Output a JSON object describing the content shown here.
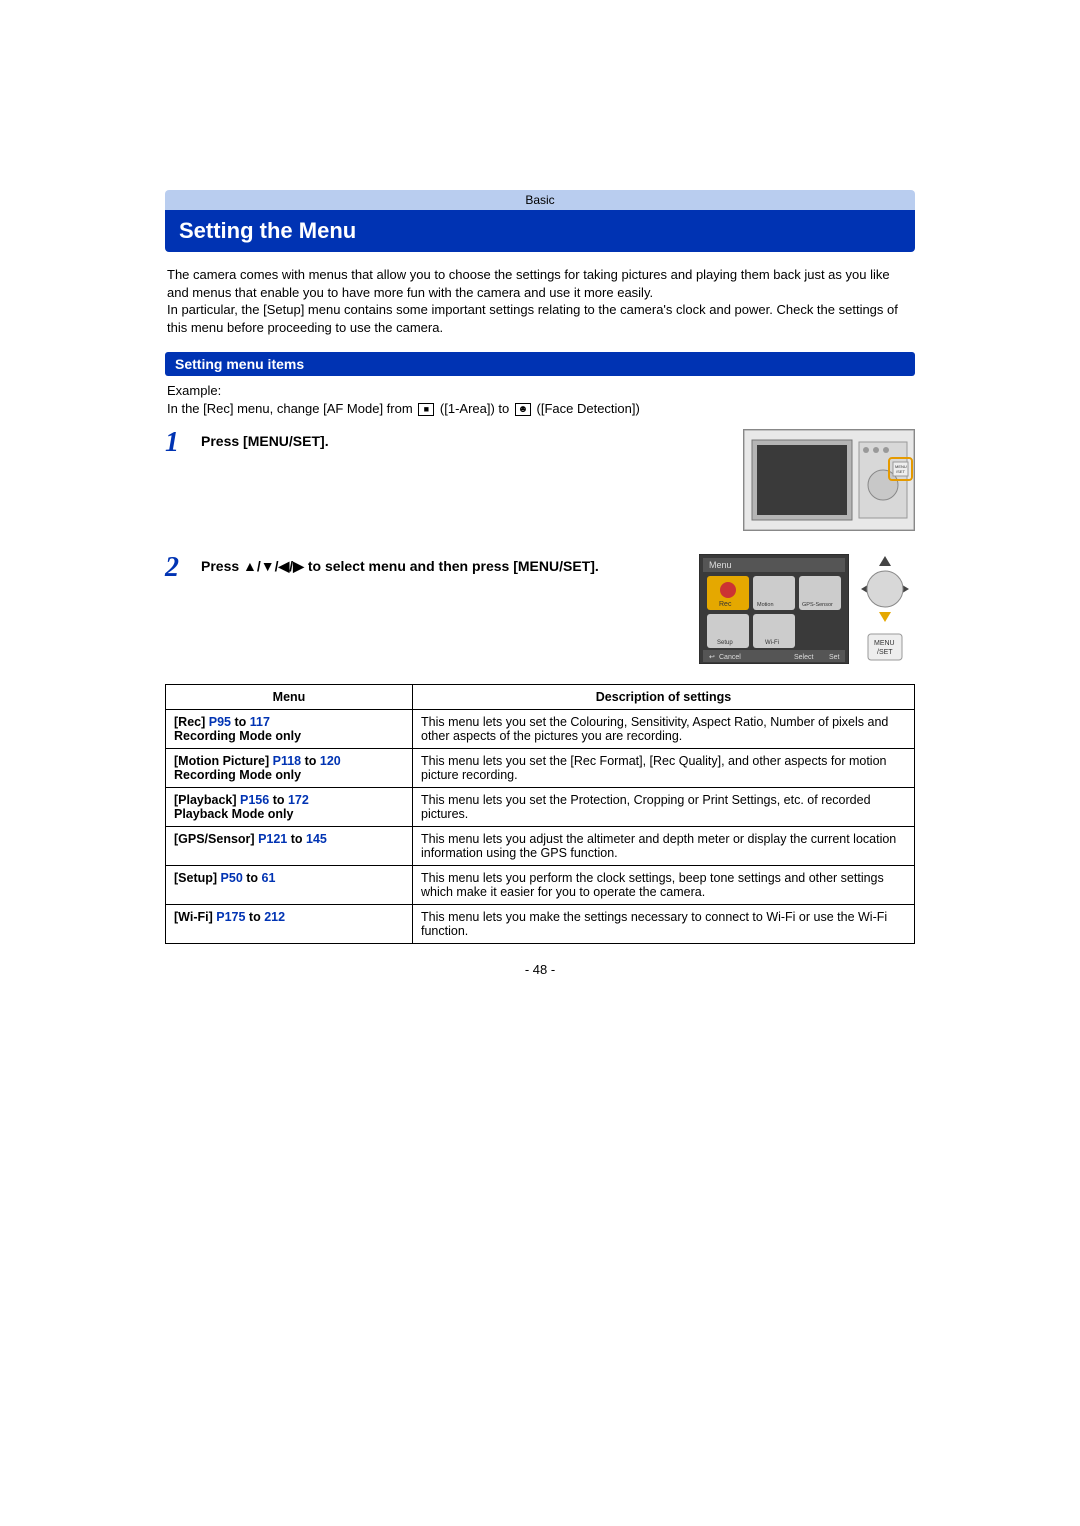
{
  "breadcrumb": "Basic",
  "title": "Setting the Menu",
  "intro_p1": "The camera comes with menus that allow you to choose the settings for taking pictures and playing them back just as you like and menus that enable you to have more fun with the camera and use it more easily.",
  "intro_p2": "In particular, the [Setup] menu contains some important settings relating to the camera's clock and power. Check the settings of this menu before proceeding to use the camera.",
  "section_header": "Setting menu items",
  "example_label": "Example:",
  "example_line_a": "In the [Rec] menu, change [AF Mode] from ",
  "example_line_b": " ([1-Area]) to ",
  "example_line_c": " ([Face Detection])",
  "step1": {
    "num": "1",
    "text": "Press [MENU/SET]."
  },
  "step2": {
    "num": "2",
    "text": "Press ▲/▼/◀/▶ to select menu and then press [MENU/SET]."
  },
  "menu_screen": {
    "title": "Menu",
    "items": [
      "Rec",
      "Motion Picture",
      "GPS-Sensor",
      "Setup",
      "Wi-Fi"
    ],
    "cancel": "Cancel",
    "select": "Select",
    "set": "Set"
  },
  "dpad_label": "MENU\n/SET",
  "table": {
    "headers": {
      "menu": "Menu",
      "desc": "Description of settings"
    },
    "rows": [
      {
        "name": "[Rec]",
        "link1": "P95",
        "to": " to ",
        "link2": "117",
        "note": "Recording Mode only",
        "desc": "This menu lets you set the Colouring, Sensitivity, Aspect Ratio, Number of pixels and other aspects of the pictures you are recording."
      },
      {
        "name": "[Motion Picture]",
        "link1": "P118",
        "to": " to ",
        "link2": "120",
        "note": "Recording Mode only",
        "desc": "This menu lets you set the [Rec Format], [Rec Quality], and other aspects for motion picture recording."
      },
      {
        "name": "[Playback]",
        "link1": "P156",
        "to": " to ",
        "link2": "172",
        "note": "Playback Mode only",
        "desc": "This menu lets you set the Protection, Cropping or Print Settings, etc. of recorded pictures."
      },
      {
        "name": "[GPS/Sensor]",
        "link1": "P121",
        "to": " to ",
        "link2": "145",
        "note": "",
        "desc": "This menu lets you adjust the altimeter and depth meter or display the current location information using the GPS function."
      },
      {
        "name": "[Setup]",
        "link1": "P50",
        "to": " to ",
        "link2": "61",
        "note": "",
        "desc": "This menu lets you perform the clock settings, beep tone settings and other settings which make it easier for you to operate the camera."
      },
      {
        "name": "[Wi-Fi]",
        "link1": "P175",
        "to": " to ",
        "link2": "212",
        "note": "",
        "desc": "This menu lets you make the settings necessary to connect to Wi-Fi or use the Wi-Fi function."
      }
    ]
  },
  "page_number": "- 48 -"
}
